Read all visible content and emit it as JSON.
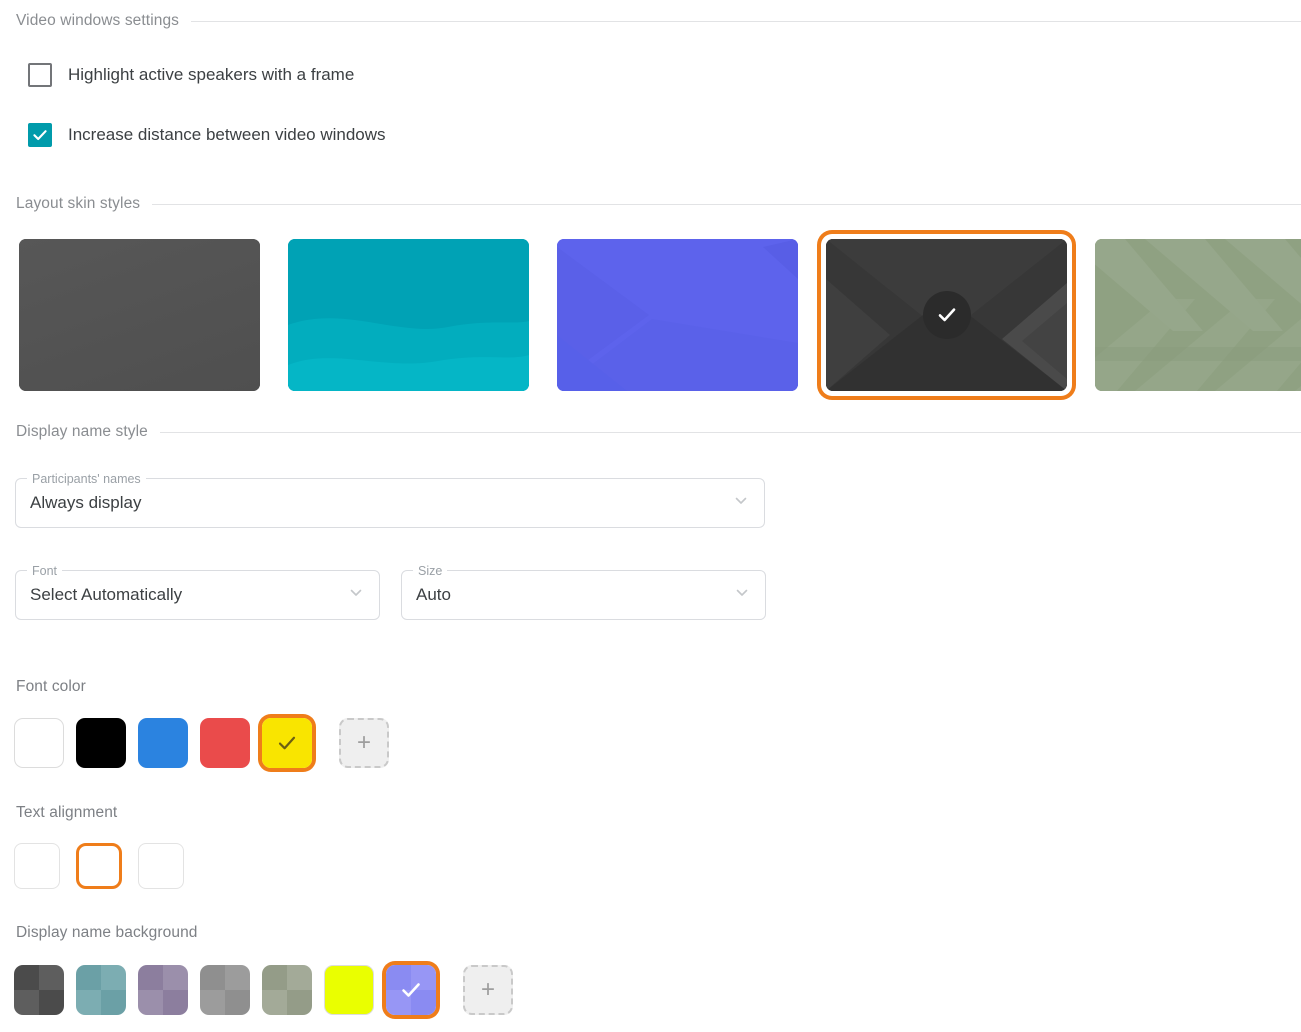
{
  "sections": {
    "video_windows": {
      "title": "Video windows settings"
    },
    "layout_skins": {
      "title": "Layout skin styles"
    },
    "display_name_style": {
      "title": "Display name style"
    }
  },
  "video_windows": {
    "checkboxes": [
      {
        "label": "Highlight active speakers with a frame",
        "checked": false,
        "name": "highlight-active-speakers"
      },
      {
        "label": "Increase distance between video windows",
        "checked": true,
        "name": "increase-distance"
      }
    ],
    "checked_color": "#009bab"
  },
  "layout_skins": {
    "selected_index": 3,
    "selection_color": "#ef7d1a",
    "items": [
      {
        "name": "skin-dark-plain",
        "base_color": "#535353",
        "pattern": "solid",
        "selected": false
      },
      {
        "name": "skin-teal-waves",
        "base_color": "#00a0b4",
        "pattern": "waves",
        "selected": false
      },
      {
        "name": "skin-indigo-angles",
        "base_color": "#5a62ea",
        "pattern": "angles",
        "selected": false
      },
      {
        "name": "skin-charcoal-chevron",
        "base_color": "#363636",
        "pattern": "chevron",
        "selected": true
      },
      {
        "name": "skin-sage-stripes",
        "base_color": "#8fa182",
        "pattern": "stripes",
        "selected": false
      }
    ],
    "selected_badge_icon": "check-icon"
  },
  "display_name_style": {
    "participants_names": {
      "legend": "Participants' names",
      "value": "Always display",
      "chevron_icon": "chevron-down-icon"
    },
    "font": {
      "legend": "Font",
      "value": "Select Automatically",
      "chevron_icon": "chevron-down-icon"
    },
    "size": {
      "legend": "Size",
      "value": "Auto",
      "chevron_icon": "chevron-down-icon"
    }
  },
  "font_color": {
    "title": "Font color",
    "selected_index": 4,
    "selection_color": "#ef7d1a",
    "check_color": "#6b5f12",
    "add_label": "+",
    "swatches": [
      {
        "name": "font-color-white",
        "color": "#ffffff",
        "bordered": true,
        "selected": false
      },
      {
        "name": "font-color-black",
        "color": "#000000",
        "bordered": false,
        "selected": false
      },
      {
        "name": "font-color-blue",
        "color": "#2b83e0",
        "bordered": false,
        "selected": false
      },
      {
        "name": "font-color-red",
        "color": "#ea4b4b",
        "bordered": false,
        "selected": false
      },
      {
        "name": "font-color-yellow",
        "color": "#f9e500",
        "bordered": false,
        "selected": true
      }
    ]
  },
  "text_alignment": {
    "title": "Text alignment",
    "selected_index": 1,
    "selection_color": "#ef7d1a",
    "options": [
      {
        "name": "align-left-button",
        "icon": "align-left-icon",
        "align": "left",
        "selected": false
      },
      {
        "name": "align-center-button",
        "icon": "align-center-icon",
        "align": "center",
        "selected": true
      },
      {
        "name": "align-right-button",
        "icon": "align-right-icon",
        "align": "right",
        "selected": false
      }
    ]
  },
  "display_name_background": {
    "title": "Display name background",
    "selected_index": 6,
    "selection_color": "#ef7d1a",
    "add_label": "+",
    "swatches": [
      {
        "name": "bg-color-dark-gray",
        "color_a": "#4b4b4b",
        "color_b": "#5e5e5e",
        "checker": true,
        "bordered": false,
        "selected": false
      },
      {
        "name": "bg-color-teal",
        "color_a": "#6ba0a6",
        "color_b": "#7cadb2",
        "checker": true,
        "bordered": false,
        "selected": false
      },
      {
        "name": "bg-color-purple",
        "color_a": "#8c7e9e",
        "color_b": "#9b8fab",
        "checker": true,
        "bordered": false,
        "selected": false
      },
      {
        "name": "bg-color-gray",
        "color_a": "#8f8f8f",
        "color_b": "#9c9c9c",
        "checker": true,
        "bordered": false,
        "selected": false
      },
      {
        "name": "bg-color-sage",
        "color_a": "#949c88",
        "color_b": "#a3aa98",
        "checker": true,
        "bordered": false,
        "selected": false
      },
      {
        "name": "bg-color-yellow",
        "color_a": "#eaff00",
        "color_b": "#eaff00",
        "checker": false,
        "bordered": true,
        "selected": false
      },
      {
        "name": "bg-color-indigo",
        "color_a": "#8a8bf2",
        "color_b": "#9796f5",
        "checker": true,
        "bordered": false,
        "selected": true
      }
    ]
  }
}
